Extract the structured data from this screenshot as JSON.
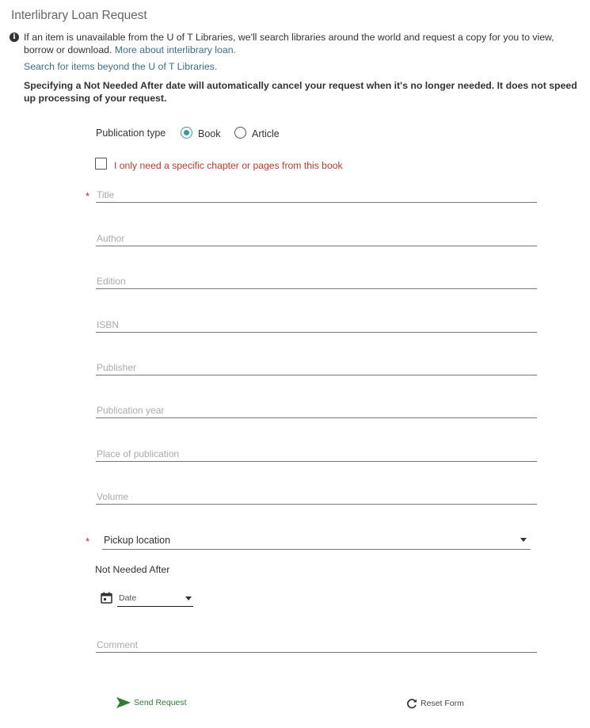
{
  "page": {
    "title": "Interlibrary Loan Request",
    "info": {
      "icon": "info-circle-icon",
      "text": "If an item is unavailable from the U of T Libraries, we'll search libraries around the world and request a copy for you to view, borrow or download. ",
      "link": "More about interlibrary loan."
    },
    "search_link": "Search for items beyond the U of T Libraries.",
    "note": "Specifying a Not Needed After date will automatically cancel your request when it's no longer needed. It does not speed up processing of your request."
  },
  "form": {
    "publication_type": {
      "label": "Publication type",
      "options": [
        {
          "label": "Book",
          "selected": true
        },
        {
          "label": "Article",
          "selected": false
        }
      ]
    },
    "chapter_checkbox": {
      "label": "I only need a specific chapter or pages from this book",
      "checked": false
    },
    "required_marker": "*",
    "fields": [
      {
        "placeholder": "Title",
        "value": "",
        "required": true
      },
      {
        "placeholder": "Author",
        "value": "",
        "required": false
      },
      {
        "placeholder": "Edition",
        "value": "",
        "required": false
      },
      {
        "placeholder": "ISBN",
        "value": "",
        "required": false
      },
      {
        "placeholder": "Publisher",
        "value": "",
        "required": false
      },
      {
        "placeholder": "Publication year",
        "value": "",
        "required": false
      },
      {
        "placeholder": "Place of publication",
        "value": "",
        "required": false
      },
      {
        "placeholder": "Volume",
        "value": "",
        "required": false
      }
    ],
    "pickup_location": {
      "label": "Pickup location",
      "required": true,
      "value": ""
    },
    "not_needed_after": {
      "label": "Not Needed After",
      "date_placeholder": "Date"
    },
    "comment": {
      "placeholder": "Comment",
      "value": ""
    }
  },
  "actions": {
    "send": "Send Request",
    "reset": "Reset Form"
  },
  "colors": {
    "accent": "#3a9aa8",
    "required": "#c8261f",
    "send": "#2e7d32",
    "link": "#3b6e8f"
  }
}
